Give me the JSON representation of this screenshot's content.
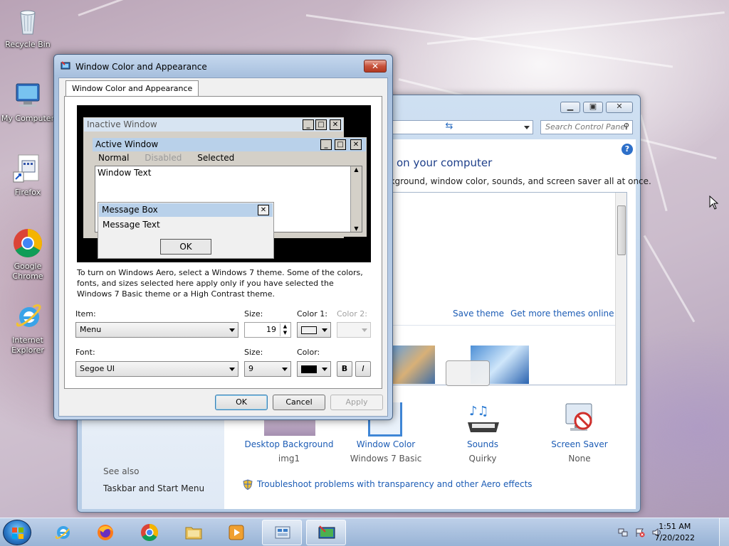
{
  "desktop": {
    "icons": [
      {
        "label": "Recycle Bin",
        "icon": "recycle-bin-icon"
      },
      {
        "label": "My Computer",
        "icon": "computer-icon"
      },
      {
        "label": "Firefox",
        "icon": "firefox-shortcut-icon"
      },
      {
        "label": "Google Chrome",
        "icon": "chrome-icon"
      },
      {
        "label": "Internet Explorer",
        "icon": "internet-explorer-icon"
      }
    ]
  },
  "control_panel": {
    "search_placeholder": "Search Control Panel",
    "heading": "on your computer",
    "subtext": "ckground, window color, sounds, and screen saver all at once.",
    "save_theme": "Save theme",
    "get_more_themes": "Get more themes online",
    "see_also": "See also",
    "taskbar_link": "Taskbar and Start Menu",
    "bottom_items": [
      {
        "label": "Desktop Background",
        "value": "img1"
      },
      {
        "label": "Window Color",
        "value": "Windows 7 Basic"
      },
      {
        "label": "Sounds",
        "value": "Quirky"
      },
      {
        "label": "Screen Saver",
        "value": "None"
      }
    ],
    "troubleshoot": "Troubleshoot problems with transparency and other Aero effects",
    "help_glyph": "?"
  },
  "dialog": {
    "title": "Window Color and Appearance",
    "tab": "Window Color and Appearance",
    "preview": {
      "inactive_title": "Inactive Window",
      "active_title": "Active Window",
      "menu_normal": "Normal",
      "menu_disabled": "Disabled",
      "menu_selected": "Selected",
      "window_text": "Window Text",
      "message_box_title": "Message Box",
      "message_text": "Message Text",
      "ok": "OK"
    },
    "description": "To turn on Windows Aero, select a Windows 7 theme.  Some of the colors, fonts, and sizes selected here apply only if you have selected the Windows 7 Basic theme or a High Contrast theme.",
    "item_label": "Item:",
    "item_value": "Menu",
    "size_label": "Size:",
    "size_value": "19",
    "color1_label": "Color 1:",
    "color2_label": "Color 2:",
    "font_label": "Font:",
    "font_value": "Segoe UI",
    "font_size_label": "Size:",
    "font_size_value": "9",
    "font_color_label": "Color:",
    "bold": "B",
    "italic": "I",
    "ok": "OK",
    "cancel": "Cancel",
    "apply": "Apply"
  },
  "taskbar": {
    "time": "1:51 AM",
    "date": "7/20/2022"
  },
  "colors": {
    "title_active": "#b9d1ea",
    "title_inactive": "#d7e4f2",
    "link": "#1c5cb5"
  }
}
